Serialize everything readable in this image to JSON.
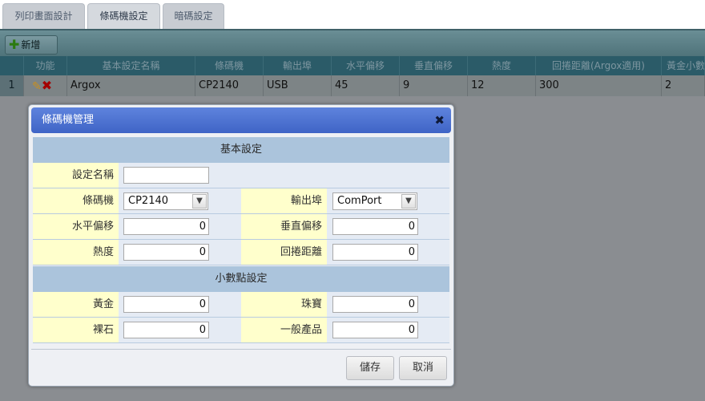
{
  "tabs": [
    {
      "label": "列印畫面設計"
    },
    {
      "label": "條碼機設定"
    },
    {
      "label": "暗碼設定"
    }
  ],
  "toolbar": {
    "add_label": "新增"
  },
  "grid": {
    "headers": [
      "功能",
      "基本設定名稱",
      "條碼機",
      "輸出埠",
      "水平偏移",
      "垂直偏移",
      "熱度",
      "回捲距離(Argox適用)",
      "黃金小數"
    ],
    "rows": [
      {
        "num": "1",
        "name": "Argox",
        "printer": "CP2140",
        "port": "USB",
        "h_offset": "45",
        "v_offset": "9",
        "heat": "12",
        "backfeed": "300",
        "gold": "2"
      }
    ]
  },
  "dialog": {
    "title": "條碼機管理",
    "section_basic": "基本設定",
    "section_decimal": "小數點設定",
    "fields": {
      "setting_name": {
        "label": "設定名稱",
        "value": ""
      },
      "printer": {
        "label": "條碼機",
        "value": "CP2140"
      },
      "port": {
        "label": "輸出埠",
        "value": "ComPort"
      },
      "h_offset": {
        "label": "水平偏移",
        "value": "0"
      },
      "v_offset": {
        "label": "垂直偏移",
        "value": "0"
      },
      "heat": {
        "label": "熱度",
        "value": "0"
      },
      "backfeed": {
        "label": "回捲距離",
        "value": "0"
      },
      "gold": {
        "label": "黃金",
        "value": "0"
      },
      "jewelry": {
        "label": "珠寶",
        "value": "0"
      },
      "loose_stone": {
        "label": "裸石",
        "value": "0"
      },
      "general": {
        "label": "一般產品",
        "value": "0"
      }
    },
    "save_label": "儲存",
    "cancel_label": "取消"
  }
}
